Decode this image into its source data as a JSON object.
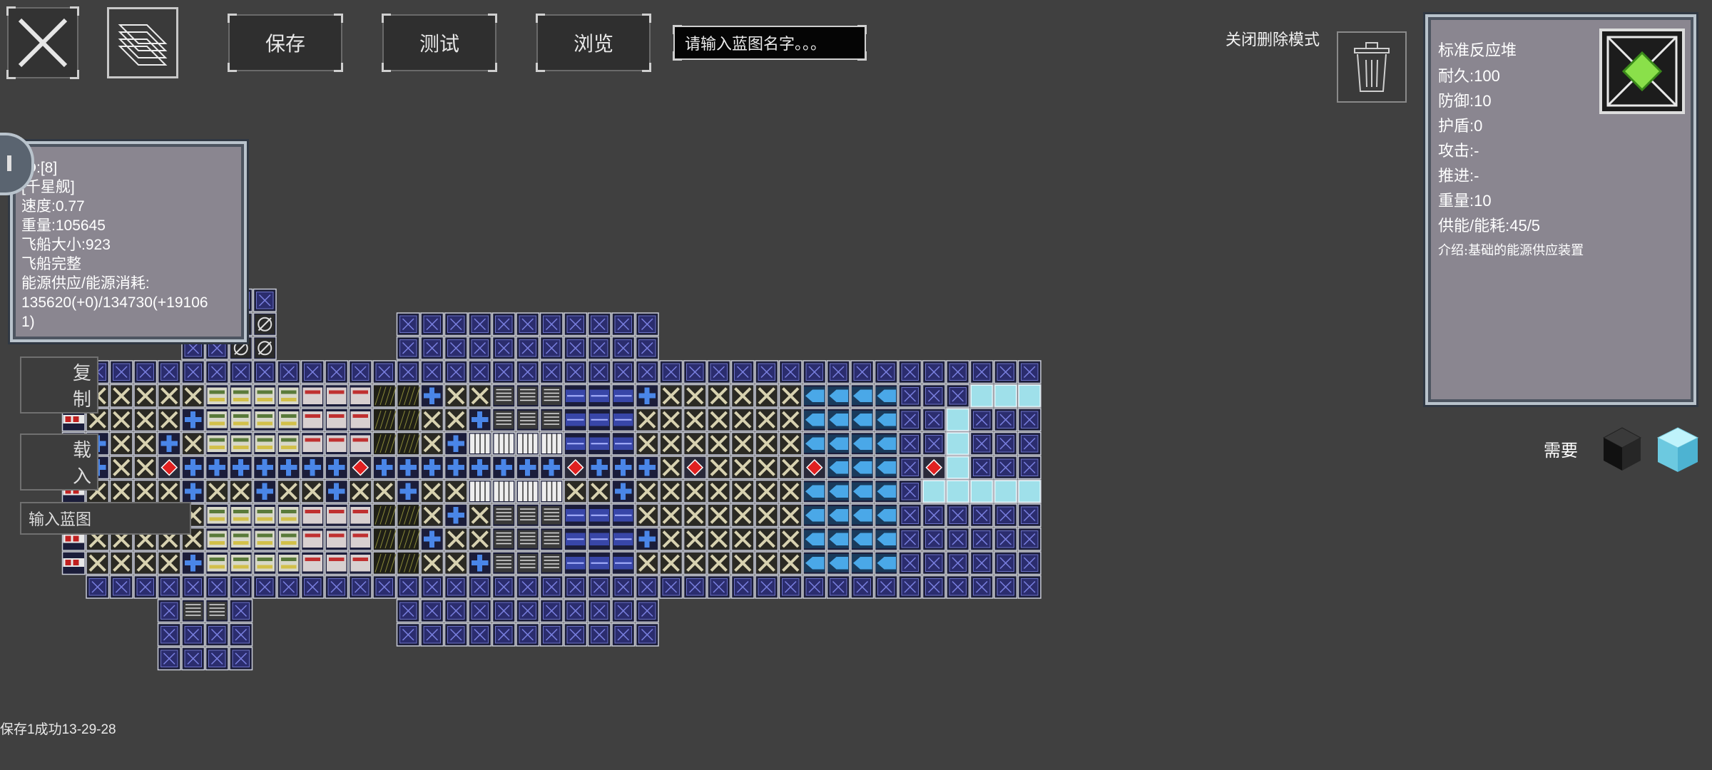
{
  "toolbar": {
    "close_icon": "x-close-icon",
    "blueprint_icon": "blueprint-stack-icon",
    "save_label": "保存",
    "test_label": "测试",
    "browse_label": "浏览",
    "name_placeholder": "请输入蓝图名字。。。",
    "delete_mode_label": "关闭删除模式",
    "trash_icon": "trash-can-icon"
  },
  "ship_info": {
    "id": "ID:[8]",
    "class": "[千星舰]",
    "speed": "速度:0.77",
    "weight": "重量:105645",
    "size": "飞船大小:923",
    "status": "飞船完整",
    "energy_label": "能源供应/能源消耗:",
    "energy_value": "135620(+0)/134730(+19106",
    "energy_value_cont": "1)"
  },
  "module_info": {
    "name": "标准反应堆",
    "durability": "耐久:100",
    "defense": "防御:10",
    "shield": "护盾:0",
    "attack": "攻击:-",
    "thrust": "推进:-",
    "weight": "重量:10",
    "power": "供能/能耗:45/5",
    "description": "介绍:基础的能源供应装置",
    "icon": "reactor-core-icon"
  },
  "side_buttons": {
    "copy": "复制",
    "load": "载入",
    "input": "输入蓝图"
  },
  "palette": {
    "label": "需要",
    "dark_cube_icon": "dark-armor-cube-icon",
    "light_cube_icon": "ice-armor-cube-icon"
  },
  "status_message": "保存1成功13-29-28",
  "colors": {
    "background": "#404040",
    "panel": "#8a8690",
    "armor_blue": "#2b2d6e",
    "armor_x": "#d8d2b0",
    "reactor": "#e02020",
    "thruster_blue": "#4aa8e8",
    "ice_armor": "#9fe0ea"
  }
}
